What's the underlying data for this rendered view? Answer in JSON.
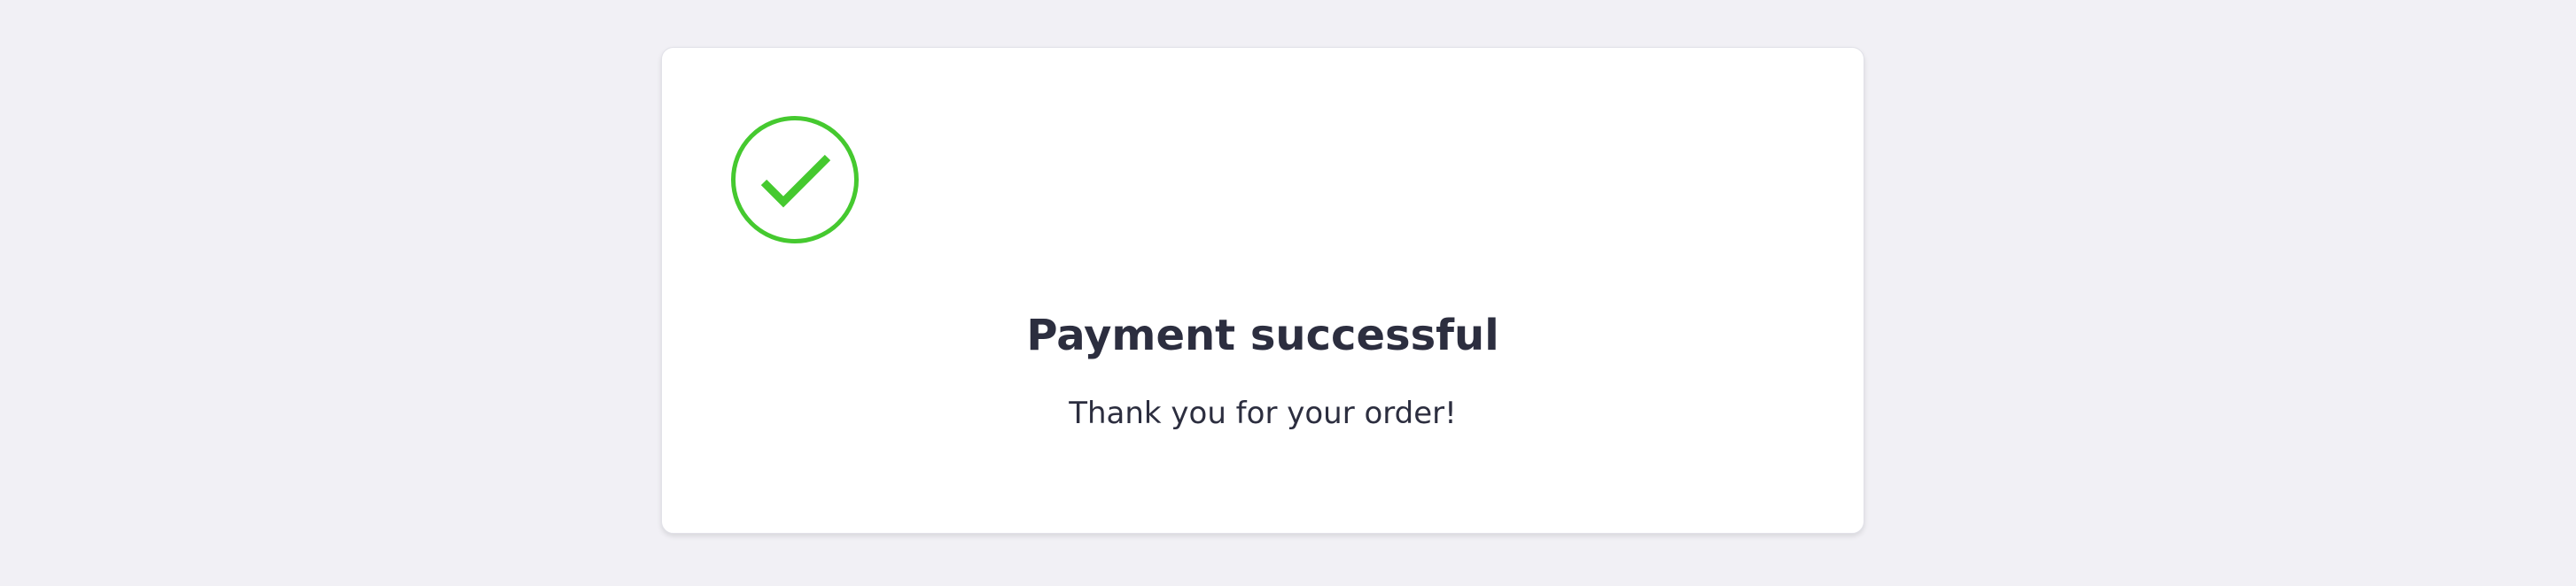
{
  "status": {
    "icon": "check-circle-icon",
    "color": "#45c92f",
    "title": "Payment successful",
    "message": "Thank you for your order!"
  }
}
